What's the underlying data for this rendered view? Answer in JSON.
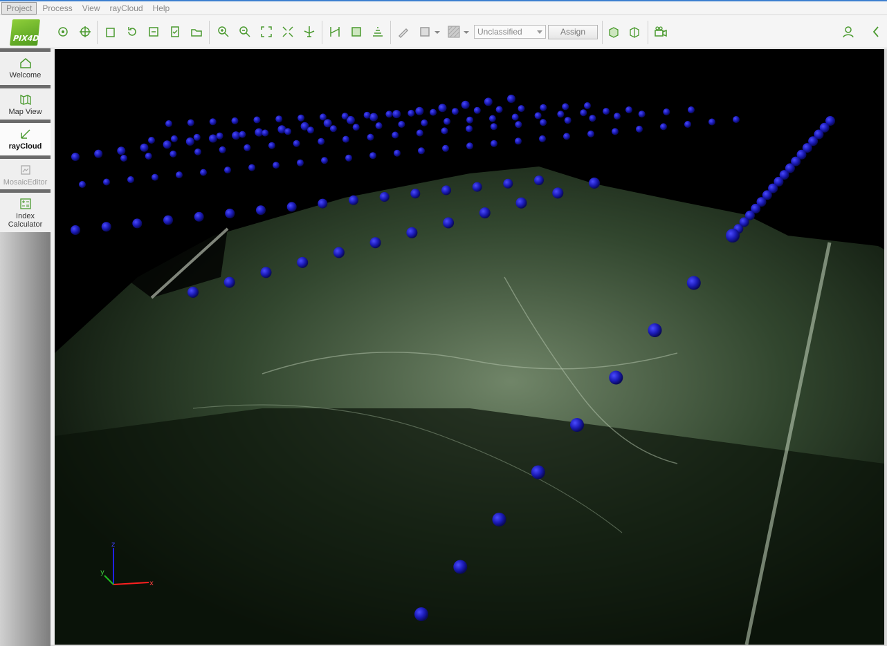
{
  "menubar": {
    "items": [
      "Project",
      "Process",
      "View",
      "rayCloud",
      "Help"
    ],
    "active": "Project"
  },
  "logo": {
    "text": "PIX4D"
  },
  "toolbar": {
    "classification_value": "Unclassified",
    "assign_label": "Assign"
  },
  "sidebar": {
    "items": [
      {
        "label": "Welcome",
        "icon": "home-icon",
        "state": "normal"
      },
      {
        "label": "Map View",
        "icon": "map-icon",
        "state": "normal"
      },
      {
        "label": "rayCloud",
        "icon": "raycloud-icon",
        "state": "active"
      },
      {
        "label": "MosaicEditor",
        "icon": "mosaic-icon",
        "state": "disabled"
      },
      {
        "label": "Index Calculator",
        "icon": "calculator-icon",
        "state": "normal"
      }
    ]
  },
  "axes": {
    "x": "x",
    "y": "y",
    "z": "z"
  },
  "colors": {
    "accent": "#4f9a1e",
    "camera_sphere": "#1a1aa8",
    "background": "#000000",
    "terrain": "#5d7a5a"
  }
}
